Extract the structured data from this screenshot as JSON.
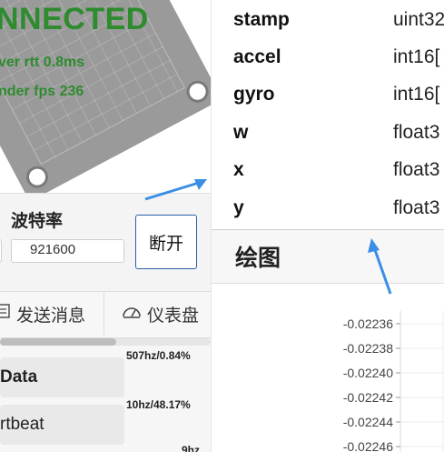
{
  "device": {
    "status": "NNECTED",
    "rtt": "ver rtt 0.8ms",
    "fps": "nder fps 236"
  },
  "baud": {
    "label": "波特率",
    "value": "921600",
    "disconnect_label": "断开"
  },
  "tabs": [
    {
      "label": "发送消息",
      "icon": "message-icon"
    },
    {
      "label": "仪表盘",
      "icon": "gauge-icon"
    }
  ],
  "progress": 0.55,
  "messages": [
    {
      "label": "Data",
      "rate": "507hz/0.84%"
    },
    {
      "label": "rtbeat",
      "rate": "10hz/48.17%"
    },
    {
      "label": "",
      "rate": "9hz"
    }
  ],
  "fields": [
    {
      "name": "stamp",
      "type": "uint32"
    },
    {
      "name": "accel",
      "type": "int16["
    },
    {
      "name": "gyro",
      "type": "int16["
    },
    {
      "name": "w",
      "type": "float3"
    },
    {
      "name": "x",
      "type": "float3"
    },
    {
      "name": "y",
      "type": "float3"
    }
  ],
  "plot": {
    "title": "绘图"
  },
  "chart_data": {
    "type": "line",
    "title": "",
    "ylim": [
      -0.02246,
      -0.02236
    ],
    "ytick_labels": [
      "-0.02236",
      "-0.02238",
      "-0.02240",
      "-0.02242",
      "-0.02244",
      "-0.02246"
    ],
    "series": []
  },
  "colors": {
    "status_green": "#2e8b2e",
    "arrow_blue": "#3a8ee6",
    "button_border": "#2a5fa8"
  }
}
